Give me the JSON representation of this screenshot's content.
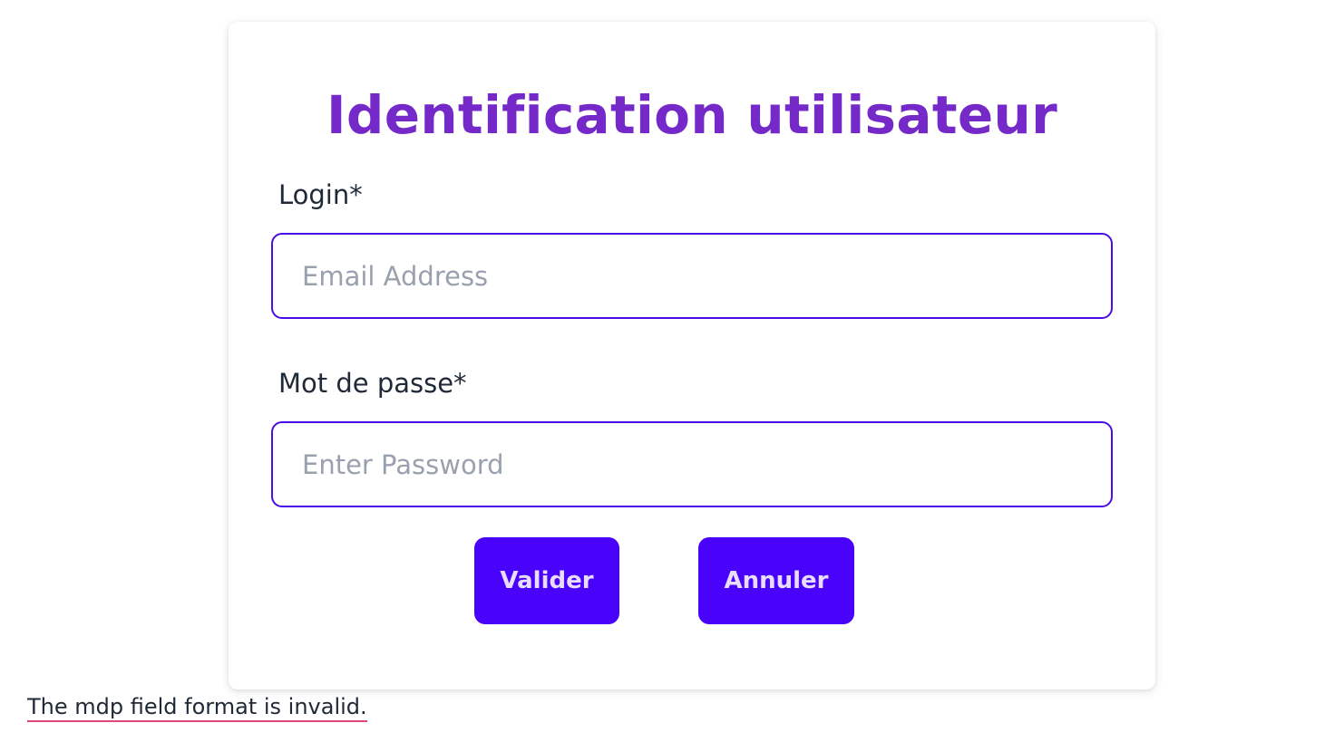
{
  "form": {
    "title": "Identification utilisateur",
    "login_label": "Login*",
    "login_placeholder": "Email Address",
    "login_value": "",
    "password_label": "Mot de passe*",
    "password_placeholder": "Enter Password",
    "password_value": "",
    "submit_label": "Valider",
    "cancel_label": "Annuler"
  },
  "validation": {
    "error_message": "The mdp field format is invalid."
  },
  "colors": {
    "title": "#7529c9",
    "input_border": "#4a0de8",
    "button_bg": "#4a03fa",
    "button_text": "#e9ddff",
    "error_underline": "#e0457b"
  }
}
